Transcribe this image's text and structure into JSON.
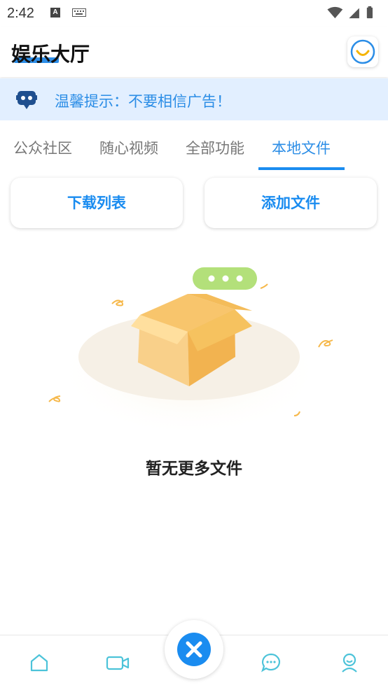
{
  "status_bar": {
    "time": "2:42",
    "a_badge": "A"
  },
  "app_bar": {
    "title": "娱乐大厅",
    "avatar_icon": "smile-icon"
  },
  "notice": {
    "text": "温馨提示：不要相信广告！",
    "icon": "robot-icon"
  },
  "tabs": [
    {
      "label": "公众社区",
      "active": false
    },
    {
      "label": "随心视频",
      "active": false
    },
    {
      "label": "全部功能",
      "active": false
    },
    {
      "label": "本地文件",
      "active": true
    }
  ],
  "actions": {
    "download_list": "下载列表",
    "add_file": "添加文件"
  },
  "empty_state": {
    "text": "暂无更多文件",
    "illustration": "empty-box-icon"
  },
  "bottom_nav": {
    "items": [
      "home-icon",
      "video-icon",
      "close-circle-icon",
      "chat-icon",
      "user-icon"
    ]
  },
  "colors": {
    "accent": "#1a8cf0",
    "notice_bg": "#e2efff",
    "tab_inactive": "#777777"
  }
}
